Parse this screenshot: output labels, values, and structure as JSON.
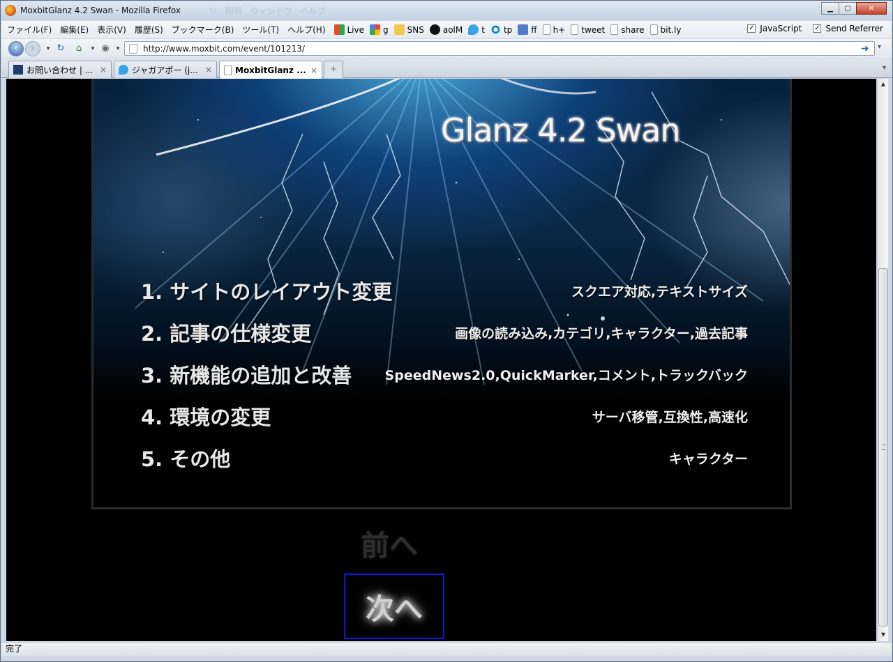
{
  "window": {
    "title": "MoxbitGlanz 4.2 Swan - Mozilla Firefox",
    "ghost_menu": "ツ　同期　ウィンドウ　ヘルプ"
  },
  "menubar": {
    "menus": [
      "ファイル(F)",
      "編集(E)",
      "表示(V)",
      "履歴(S)",
      "ブックマーク(B)",
      "ツール(T)",
      "ヘルプ(H)"
    ],
    "bookmarks": [
      "Live",
      "g",
      "SNS",
      "aolM",
      "t",
      "tp",
      "ff",
      "h+",
      "tweet",
      "share",
      "bit.ly"
    ],
    "checks": [
      "JavaScript",
      "Send Referrer"
    ]
  },
  "navbar": {
    "url": "http://www.moxbit.com/event/101213/"
  },
  "tabs": [
    {
      "label": "お問い合わせ | ..."
    },
    {
      "label": "ジャガアポー (j..."
    },
    {
      "label": "MoxbitGlanz ..."
    }
  ],
  "hero": {
    "title": "Glanz 4.2 Swan",
    "items": [
      {
        "head": "1. サイトのレイアウト変更",
        "desc": "スクエア対応,テキストサイズ"
      },
      {
        "head": "2. 記事の仕様変更",
        "desc": "画像の読み込み,カテゴリ,キャラクター,過去記事"
      },
      {
        "head": "3. 新機能の追加と改善",
        "desc": "SpeedNews2.0,QuickMarker,コメント,トラックバック"
      },
      {
        "head": "4. 環境の変更",
        "desc": "サーバ移管,互換性,高速化"
      },
      {
        "head": "5. その他",
        "desc": "キャラクター"
      }
    ]
  },
  "pager": {
    "prev": "前へ",
    "next": "次へ"
  },
  "statusbar": {
    "text": "完了"
  }
}
